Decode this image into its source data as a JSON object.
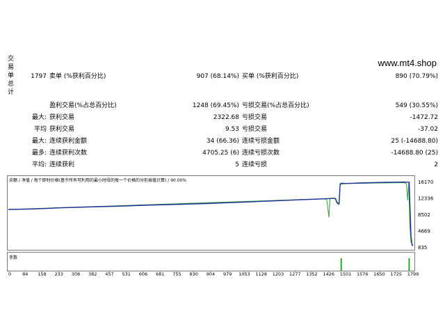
{
  "sidebar": {
    "chars": [
      "交",
      "易",
      "单",
      "总",
      "计"
    ]
  },
  "watermark": "www.mt4.shop",
  "summary": {
    "rows": [
      {
        "c1": "1797",
        "c2": "卖单 (%获利百分比)",
        "c3": "907 (68.14%)",
        "c4": "买单 (%获利百分比)",
        "c5": "890 (70.79%)"
      },
      {
        "c1": "",
        "c2": "盈利交易(%占总百分比)",
        "c3": "1248 (69.45%)",
        "c4": "亏损交易(%占总百分比)",
        "c5": "549 (30.55%)"
      },
      {
        "c1": "最大:",
        "c2": "获利交易",
        "c3": "2322.68",
        "c4": "亏损交易",
        "c5": "-1472.72"
      },
      {
        "c1": "平均",
        "c2": "获利交易",
        "c3": "9.53",
        "c4": "亏损交易",
        "c5": "-37.02"
      },
      {
        "c1": "最大:",
        "c2": "连续获利金额",
        "c3": "34 (66.36)",
        "c4": "连续亏损金额",
        "c5": "25 (-14688.80)"
      },
      {
        "c1": "最多:",
        "c2": "连续获利次数",
        "c3": "4705.25 (6)",
        "c4": "连续亏损次数",
        "c5": "-14688.80 (25)"
      },
      {
        "c1": "平均:",
        "c2": "连续获利",
        "c3": "5",
        "c4": "连续亏损",
        "c5": "2"
      }
    ]
  },
  "chart": {
    "header": "余额 / 净值 / 每个即时价格(基于所有可利用的最小时段的每一个价格的分形插值计算) / 90.00%",
    "volume_label": "手数",
    "colors": {
      "balance": "#1c2f9c",
      "equity": "#3ca83c",
      "volume": "#1aa01a",
      "frame": "#7a7a7a"
    }
  },
  "chart_data": {
    "type": "line",
    "ylabels": [
      "16170",
      "12336",
      "8502",
      "4669",
      "835"
    ],
    "xlabels": [
      "0",
      "84",
      "158",
      "233",
      "308",
      "382",
      "457",
      "531",
      "606",
      "681",
      "755",
      "830",
      "904",
      "979",
      "1053",
      "1128",
      "1203",
      "1277",
      "1352",
      "1426",
      "1501",
      "1576",
      "1650",
      "1725",
      "1799"
    ],
    "ylim": [
      835,
      16170
    ],
    "xlim": [
      0,
      1799
    ],
    "series": [
      {
        "id": "balance",
        "x": [
          0,
          80,
          160,
          240,
          320,
          400,
          480,
          560,
          640,
          720,
          800,
          880,
          960,
          1040,
          1120,
          1200,
          1280,
          1360,
          1440,
          1450,
          1455,
          1460,
          1465,
          1470,
          1475,
          1480,
          1500,
          1560,
          1620,
          1680,
          1720,
          1760,
          1782,
          1785,
          1790,
          1795,
          1799
        ],
        "y": [
          9800,
          9880,
          10020,
          10200,
          10330,
          10460,
          10560,
          10700,
          10830,
          10950,
          11060,
          11200,
          11340,
          11510,
          11700,
          11870,
          12040,
          12200,
          12380,
          12450,
          12300,
          11500,
          11200,
          11050,
          15800,
          15950,
          15900,
          16000,
          16100,
          16170,
          16200,
          16220,
          16180,
          11000,
          3500,
          1400,
          1300
        ]
      },
      {
        "id": "equity",
        "x": [
          0,
          1400,
          1415,
          1420,
          1425,
          1430,
          1435,
          1440,
          1450,
          1470,
          1475,
          1500,
          1760,
          1770,
          1775,
          1780,
          1785,
          1790,
          1799
        ],
        "y": [
          9800,
          12300,
          12200,
          10200,
          8000,
          12350,
          12400,
          12450,
          12400,
          11000,
          15700,
          15900,
          16100,
          15800,
          12000,
          16150,
          6000,
          2200,
          1300
        ]
      }
    ]
  }
}
